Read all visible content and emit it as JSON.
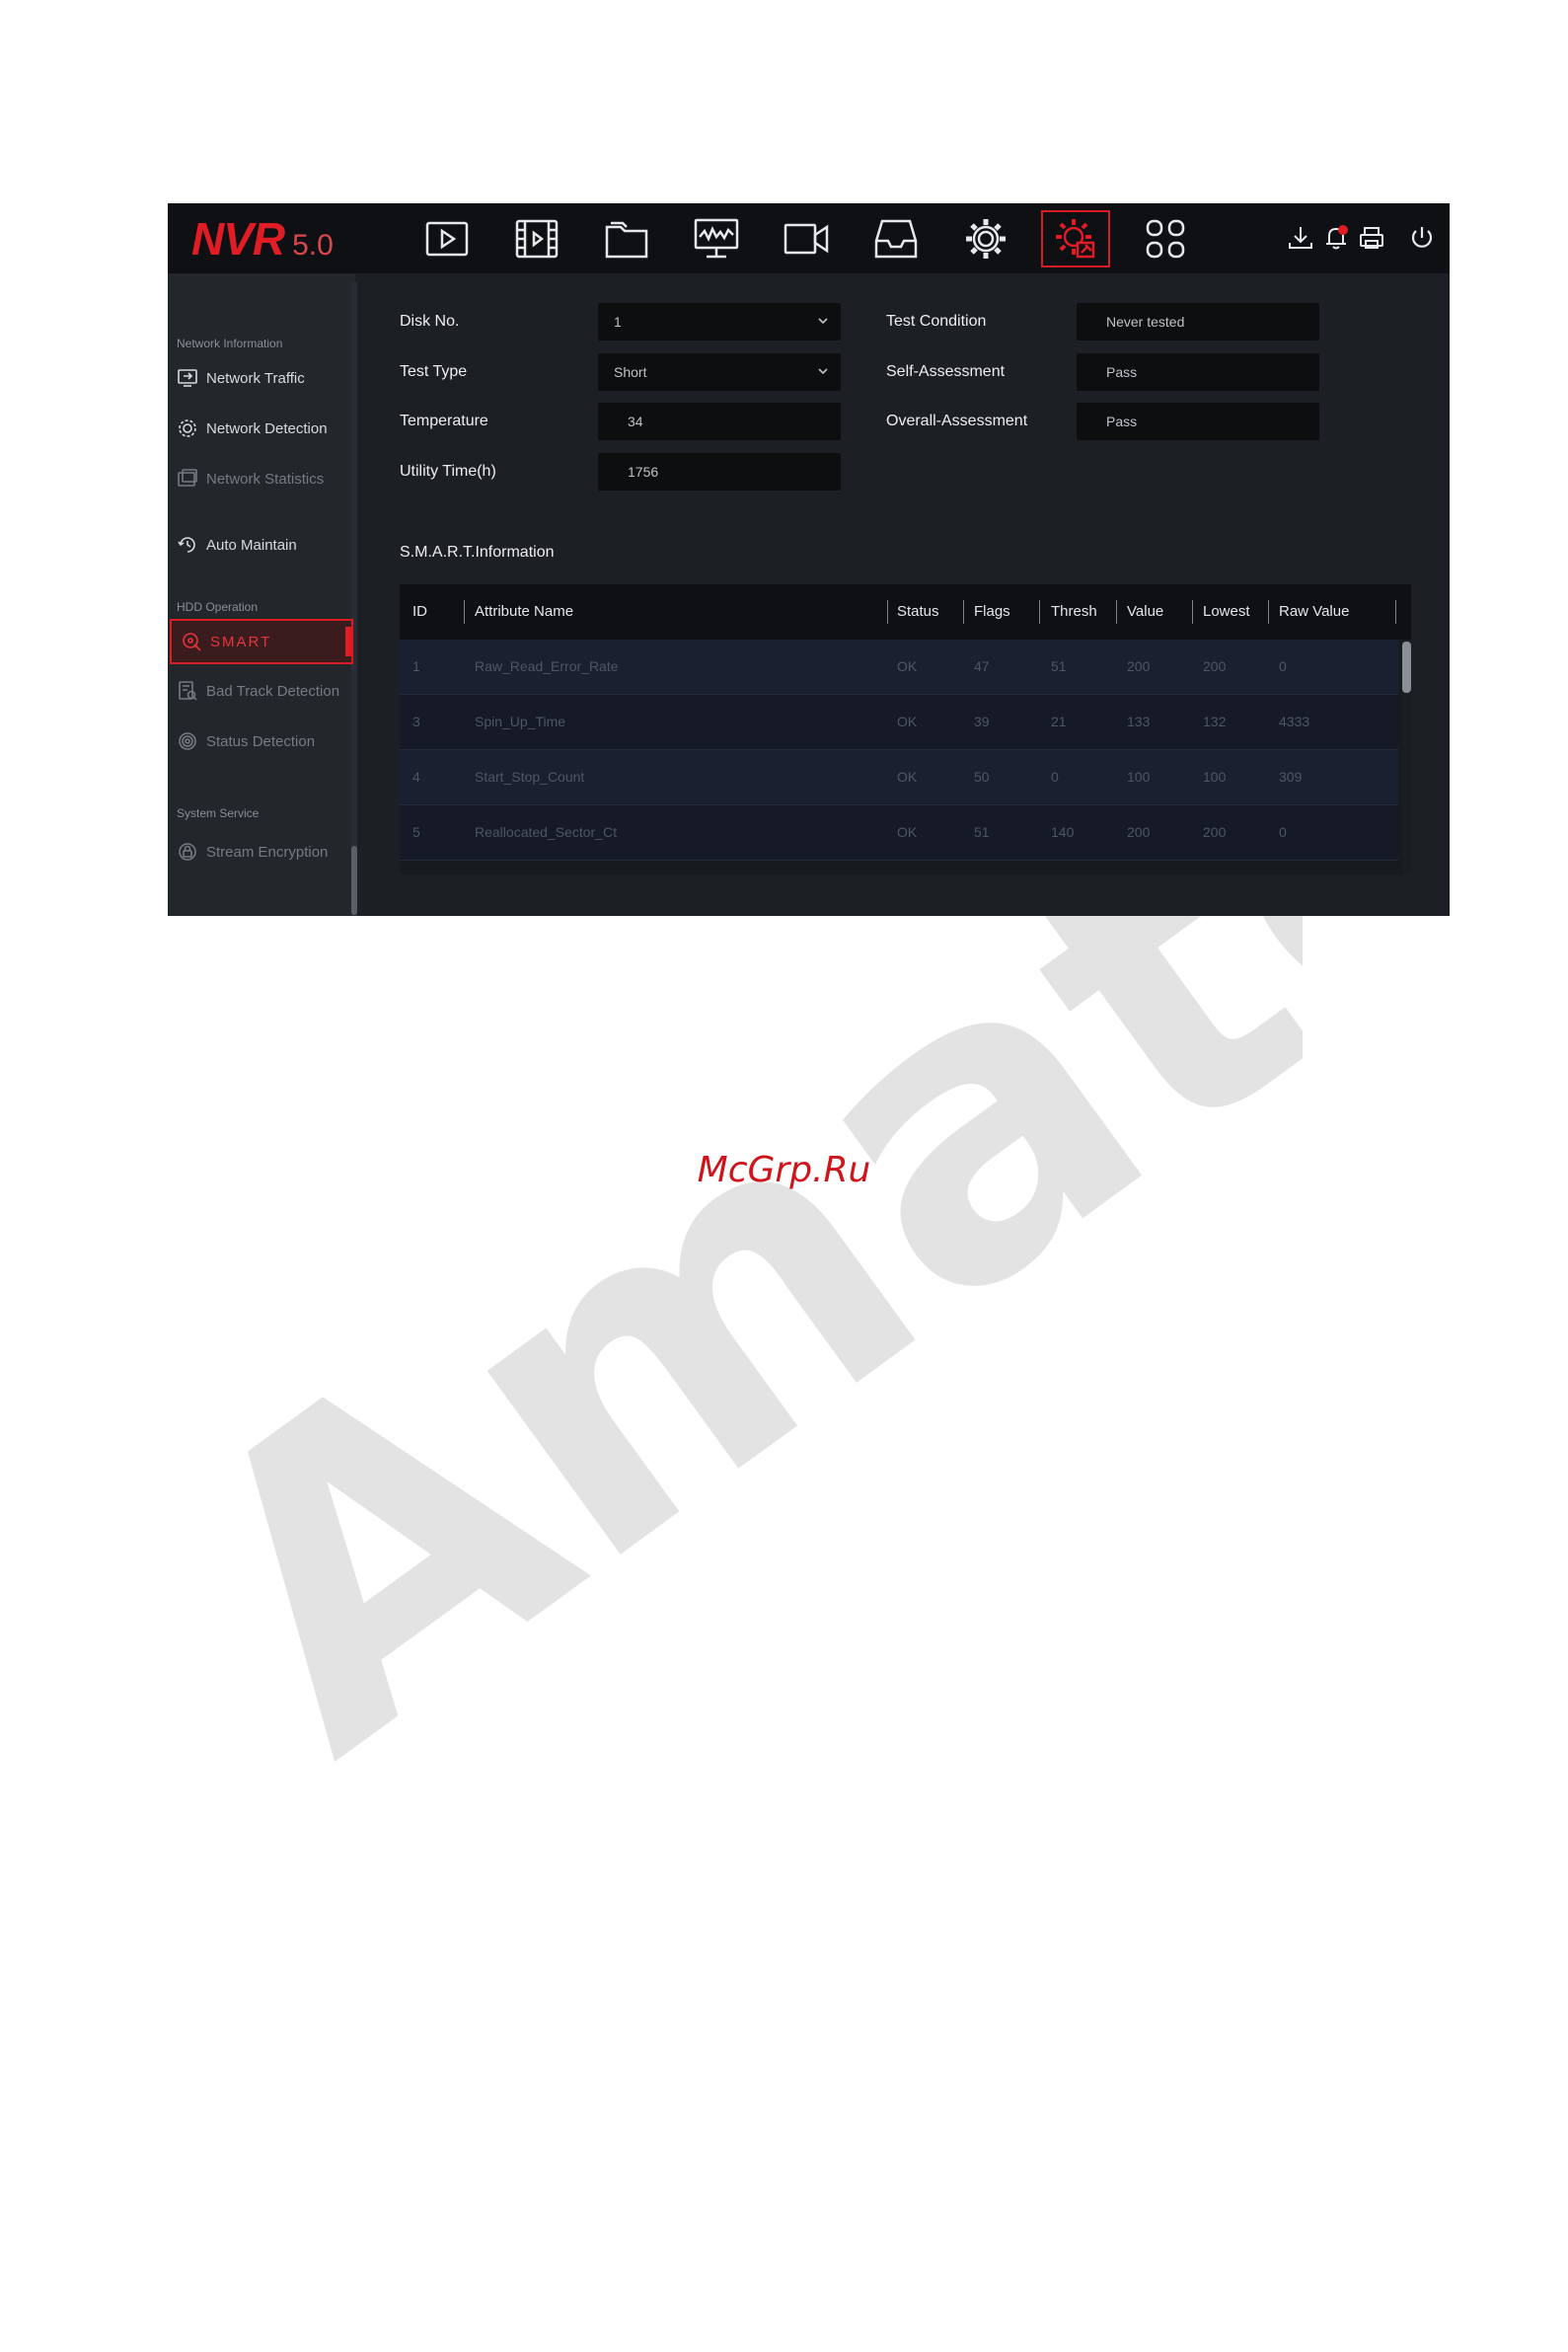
{
  "watermark": {
    "site": "McGrp.Ru",
    "logo_text": "Amateur"
  },
  "app": {
    "logo": "NVR",
    "version": "5.0"
  },
  "top_icons": [
    {
      "name": "playback-icon"
    },
    {
      "name": "video-clip-icon"
    },
    {
      "name": "file-folder-icon"
    },
    {
      "name": "monitor-graph-icon"
    },
    {
      "name": "camera-icon"
    },
    {
      "name": "storage-tray-icon"
    },
    {
      "name": "settings-gear-icon"
    },
    {
      "name": "maintenance-gear-icon",
      "active": true
    },
    {
      "name": "apps-grid-icon"
    }
  ],
  "system_icons": [
    "download-icon",
    "alarm-bell-icon",
    "printer-icon",
    "power-icon"
  ],
  "sidebar": {
    "sections": {
      "network_information": "Network Information",
      "hdd_operation": "HDD Operation",
      "system_service": "System Service"
    },
    "items": {
      "network_traffic": "Network Traffic",
      "network_detection": "Network Detection",
      "network_statistics": "Network Statistics",
      "auto_maintain": "Auto Maintain",
      "smart": "SMART",
      "bad_track_detection": "Bad Track Detection",
      "status_detection": "Status Detection",
      "stream_encryption": "Stream Encryption"
    }
  },
  "form": {
    "disk_no_label": "Disk No.",
    "disk_no_value": "1",
    "test_type_label": "Test Type",
    "test_type_value": "Short",
    "temperature_label": "Temperature",
    "temperature_value": "34",
    "utility_time_label": "Utility Time(h)",
    "utility_time_value": "1756",
    "test_condition_label": "Test Condition",
    "test_condition_value": "Never tested",
    "self_assessment_label": "Self-Assessment",
    "self_assessment_value": "Pass",
    "overall_assessment_label": "Overall-Assessment",
    "overall_assessment_value": "Pass"
  },
  "smart_info": {
    "title": "S.M.A.R.T.Information",
    "columns": {
      "id": "ID",
      "attribute": "Attribute Name",
      "status": "Status",
      "flags": "Flags",
      "thresh": "Thresh",
      "value": "Value",
      "lowest": "Lowest",
      "raw": "Raw Value"
    },
    "rows": [
      {
        "id": "1",
        "attribute": "Raw_Read_Error_Rate",
        "status": "OK",
        "flags": "47",
        "thresh": "51",
        "value": "200",
        "lowest": "200",
        "raw": "0"
      },
      {
        "id": "3",
        "attribute": "Spin_Up_Time",
        "status": "OK",
        "flags": "39",
        "thresh": "21",
        "value": "133",
        "lowest": "132",
        "raw": "4333"
      },
      {
        "id": "4",
        "attribute": "Start_Stop_Count",
        "status": "OK",
        "flags": "50",
        "thresh": "0",
        "value": "100",
        "lowest": "100",
        "raw": "309"
      },
      {
        "id": "5",
        "attribute": "Reallocated_Sector_Ct",
        "status": "OK",
        "flags": "51",
        "thresh": "140",
        "value": "200",
        "lowest": "200",
        "raw": "0"
      }
    ]
  },
  "colors": {
    "accent": "#e01c24",
    "background": "#1c1f24",
    "topbar": "#0f1013"
  }
}
